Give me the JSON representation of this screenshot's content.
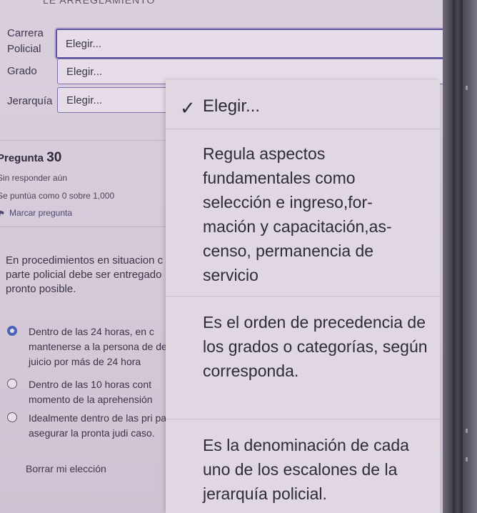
{
  "top_cut_text": "LE ARREGLAMIENTO",
  "form": {
    "carrera_label": "Carrera",
    "policial_label": "Policial",
    "carrera_select": "Elegir...",
    "grado_label": "Grado",
    "grado_select": "Elegir...",
    "jerarquia_label": "Jerarquía",
    "jerarquia_select": "Elegir..."
  },
  "question": {
    "label": "Pregunta",
    "number": "30",
    "status": "Sin responder aún",
    "score": "Se puntúa como 0 sobre 1,000",
    "flag": "Marcar pregunta",
    "text": "En procedimientos en situacion c parte policial debe ser entregado pronto posible.",
    "options": [
      {
        "text": "Dentro de las 24 horas, en c mantenerse a la persona de de juicio por más de 24 hora",
        "checked": true
      },
      {
        "text": "Dentro de las 10 horas cont momento de la aprehensión",
        "checked": false
      },
      {
        "text": "Idealmente dentro de las pri para asegurar la pronta judi caso.",
        "checked": false
      }
    ],
    "clear": "Borrar mi elección"
  },
  "dropdown": {
    "items": [
      {
        "text": "Elegir...",
        "selected": true
      },
      {
        "text": "Regula aspectos fundamentales como selección e ingreso,for- mación y capacitación,as- censo, permanencia de servicio",
        "selected": false
      },
      {
        "text": "Es el orden de precedencia de los grados o categorías, según corresponda.",
        "selected": false
      },
      {
        "text": "Es la denominación de cada uno de los escalones de la jerarquía policial.",
        "selected": false
      }
    ]
  }
}
